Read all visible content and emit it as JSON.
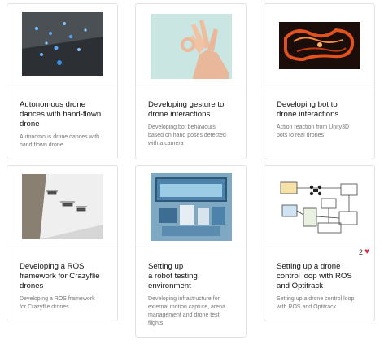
{
  "colors": {
    "heart": "#d9243b",
    "title": "#111111",
    "description": "#777777",
    "border": "#e2e2e2"
  },
  "projects": [
    {
      "title": "Autonomous drone\ndances with hand-flown\ndrone",
      "description": "Autonomous drone dances with\nhand flown drone",
      "thumbnail_icon": "drone-swarm-image"
    },
    {
      "title": "Developing gesture to\ndrone interactions",
      "description": "Developing bot behaviours\nbased on hand poses detected\nwith a camera",
      "thumbnail_icon": "hand-gesture-image"
    },
    {
      "title": "Developing bot to\ndrone interactions",
      "description": "Action reaction from Unity3D\nbots to real drones",
      "thumbnail_icon": "glowing-track-image"
    },
    {
      "title": "Developing a ROS\nframework for Crazyflie\ndrones",
      "description": "Developing a ROS framework\nfor Crazyflie drones",
      "thumbnail_icon": "drones-near-wall-image"
    },
    {
      "title": "Setting up\na robot testing\nenvironment",
      "description": "Developing infrastructure for\nexternal motion capture, arena\nmanagement and drone test\nflights",
      "thumbnail_icon": "testing-arena-image"
    },
    {
      "title": "Setting up a drone\ncontrol loop with ROS\nand Optitrack",
      "description": "Setting up a drone control loop\nwith ROS and Optitrack",
      "thumbnail_icon": "control-diagram-image",
      "likes": "2"
    }
  ]
}
